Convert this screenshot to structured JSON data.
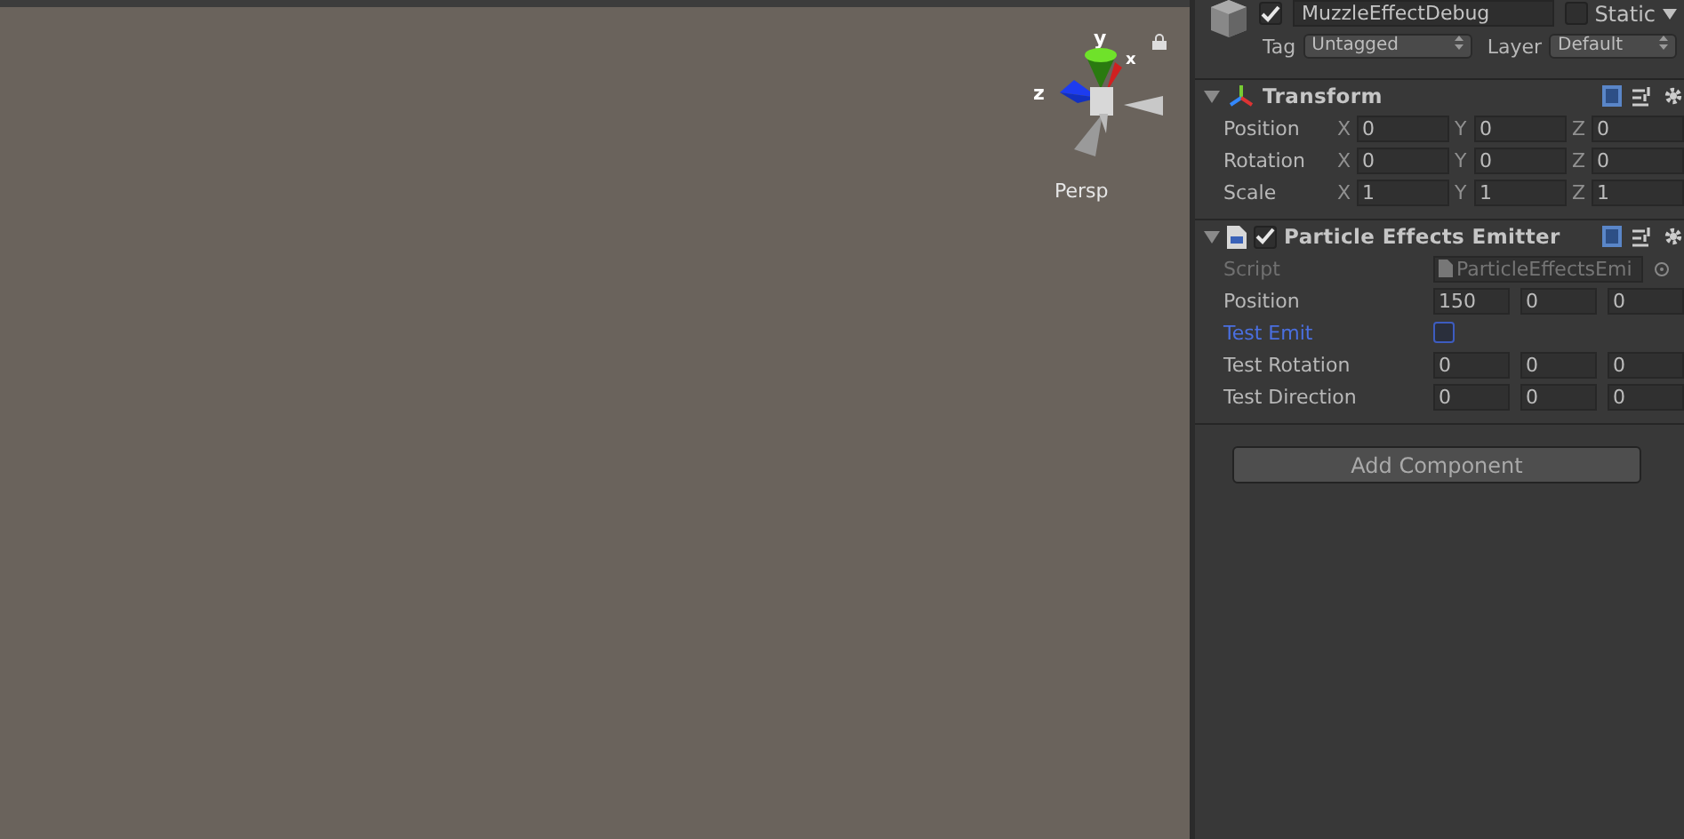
{
  "scene": {
    "axis_labels": [
      "y",
      "x",
      "z"
    ],
    "projection": "Persp"
  },
  "inspector": {
    "object": {
      "active": true,
      "name": "MuzzleEffectDebug",
      "static": false,
      "static_label": "Static",
      "tag_label": "Tag",
      "tag": "Untagged",
      "layer_label": "Layer",
      "layer": "Default"
    },
    "components": [
      {
        "kind": "transform",
        "title": "Transform",
        "expanded": true,
        "rows": [
          {
            "kind": "vector",
            "label": "Position",
            "fields": [
              {
                "axis": "X",
                "value": "0"
              },
              {
                "axis": "Y",
                "value": "0"
              },
              {
                "axis": "Z",
                "value": "0"
              }
            ]
          },
          {
            "kind": "vector",
            "label": "Rotation",
            "fields": [
              {
                "axis": "X",
                "value": "0"
              },
              {
                "axis": "Y",
                "value": "0"
              },
              {
                "axis": "Z",
                "value": "0"
              }
            ]
          },
          {
            "kind": "vector",
            "label": "Scale",
            "fields": [
              {
                "axis": "X",
                "value": "1"
              },
              {
                "axis": "Y",
                "value": "1"
              },
              {
                "axis": "Z",
                "value": "1"
              }
            ]
          }
        ]
      },
      {
        "kind": "script",
        "title": "Particle Effects Emitter",
        "enabled": true,
        "expanded": true,
        "rows": [
          {
            "kind": "object",
            "label": "Script",
            "value": "ParticleEffectsEmi",
            "disabled": true
          },
          {
            "kind": "vector",
            "label": "Position",
            "focused": false,
            "fields": [
              {
                "value": "150"
              },
              {
                "value": "0"
              },
              {
                "value": "0"
              }
            ]
          },
          {
            "kind": "toggle",
            "label": "Test Emit",
            "focused": true,
            "checked": false
          },
          {
            "kind": "vector",
            "label": "Test Rotation",
            "focused": false,
            "fields": [
              {
                "value": "0"
              },
              {
                "value": "0"
              },
              {
                "value": "0"
              }
            ]
          },
          {
            "kind": "vector",
            "label": "Test Direction",
            "focused": false,
            "fields": [
              {
                "value": "0"
              },
              {
                "value": "0"
              },
              {
                "value": "0"
              }
            ]
          }
        ]
      }
    ],
    "add_component": "Add Component"
  }
}
